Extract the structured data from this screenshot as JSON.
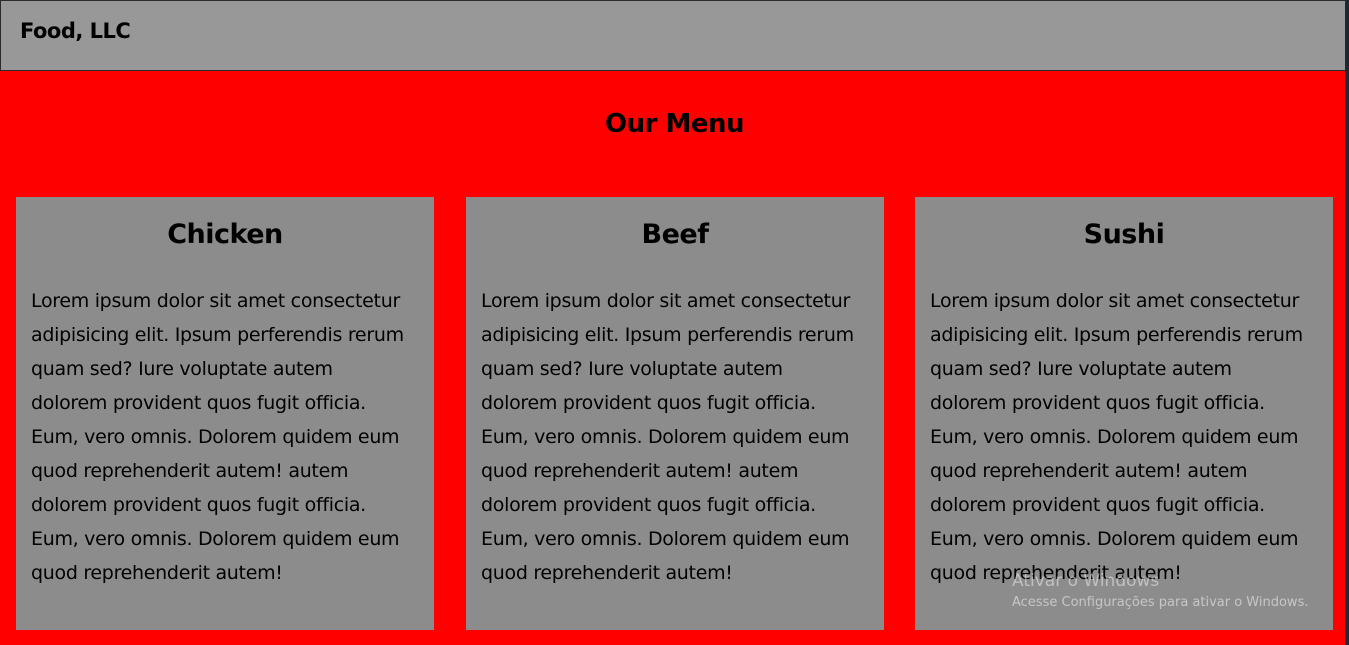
{
  "header": {
    "brand": "Food, LLC"
  },
  "menu": {
    "title": "Our Menu",
    "cards": [
      {
        "title": "Chicken",
        "text": "Lorem ipsum dolor sit amet consectetur adipisicing elit. Ipsum perferendis rerum quam sed? Iure voluptate autem dolorem provident quos fugit officia. Eum, vero omnis. Dolorem quidem eum quod reprehenderit autem! autem dolorem provident quos fugit officia. Eum, vero omnis. Dolorem quidem eum quod reprehenderit autem!"
      },
      {
        "title": "Beef",
        "text": "Lorem ipsum dolor sit amet consectetur adipisicing elit. Ipsum perferendis rerum quam sed? Iure voluptate autem dolorem provident quos fugit officia. Eum, vero omnis. Dolorem quidem eum quod reprehenderit autem! autem dolorem provident quos fugit officia. Eum, vero omnis. Dolorem quidem eum quod reprehenderit autem!"
      },
      {
        "title": "Sushi",
        "text": "Lorem ipsum dolor sit amet consectetur adipisicing elit. Ipsum perferendis rerum quam sed? Iure voluptate autem dolorem provident quos fugit officia. Eum, vero omnis. Dolorem quidem eum quod reprehenderit autem! autem dolorem provident quos fugit officia. Eum, vero omnis. Dolorem quidem eum quod reprehenderit autem!"
      }
    ]
  },
  "watermark": {
    "line1": "Ativar o Windows",
    "line2": "Acesse Configurações para ativar o Windows."
  },
  "colors": {
    "header_bg": "#989898",
    "section_bg": "#ff0000",
    "card_bg": "#8c8c8c"
  }
}
